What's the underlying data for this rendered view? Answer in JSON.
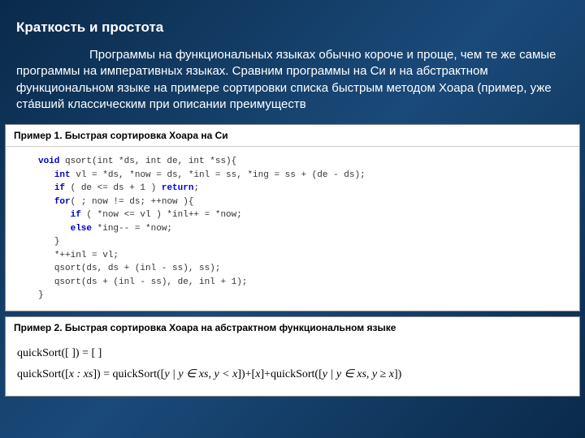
{
  "header": {
    "title": "Краткость и простота",
    "intro": "Программы на функциональных языках обычно короче и проще, чем те же самые программы на императивных языках. Сравним программы на Си и на абстрактном функциональном языке на примере сортировки списка быстрым методом Хоара (пример, уже ста́вший классическим при описании преимуществ"
  },
  "panel1": {
    "title": "Пример 1. Быстрая сортировка Хоара на Си",
    "kw_void": "void",
    "kw_int": "int",
    "kw_if": "if",
    "kw_return": "return",
    "kw_for": "for",
    "kw_else": "else",
    "sig": " qsort(int *ds, int de, int *ss){",
    "decl": " vl = *ds, *now = ds, *inl = ss, *ing = ss + (de - ds);",
    "ifline": " ( de <= ds + 1 ) ",
    "ret_semi": ";",
    "forline": "( ; now != ds; ++now ){",
    "inner_if": " ( *now <= vl ) *inl++ = *now;",
    "inner_else": " *ing-- = *now;",
    "brace": "}",
    "assign": "*++inl = vl;",
    "call1": "qsort(ds, ds + (inl - ss), ss);",
    "call2": "qsort(ds + (inl - ss), de, inl + 1);"
  },
  "panel2": {
    "title": "Пример 2. Быстрая сортировка Хоара на абстрактном функциональном языке",
    "line1_a": "quickSort([ ]) = [ ]",
    "line2_a": "quickSort([",
    "line2_b": "x : xs",
    "line2_c": "]) = quickSort([",
    "line2_d": "y | y ∈ xs, y < x",
    "line2_e": "])+[",
    "line2_f": "x",
    "line2_g": "]+quickSort([",
    "line2_h": "y | y ∈ xs, y ≥ x",
    "line2_i": "])"
  }
}
